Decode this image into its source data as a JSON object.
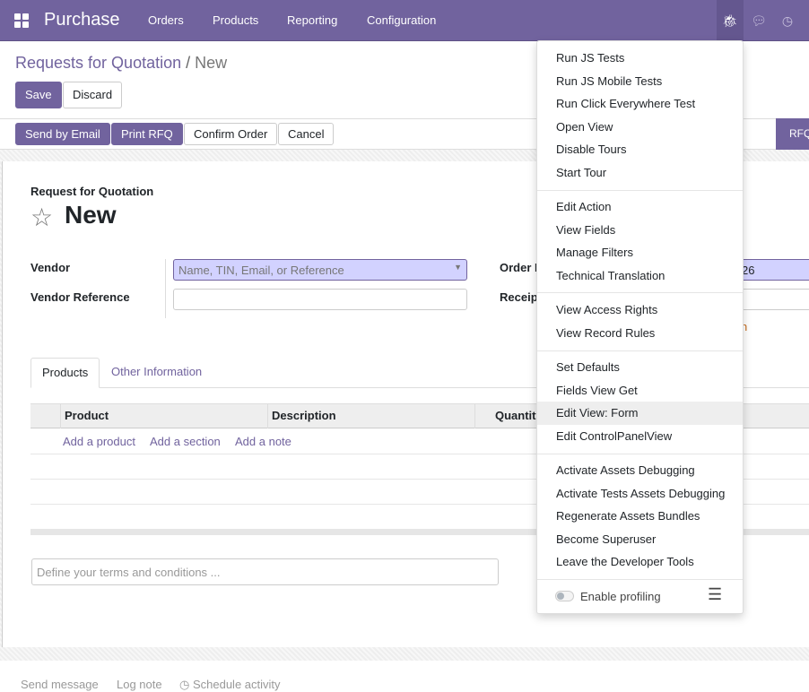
{
  "navbar": {
    "app_name": "Purchase",
    "menus": [
      "Orders",
      "Products",
      "Reporting",
      "Configuration"
    ],
    "icons": [
      "bug-icon",
      "chat-icon",
      "clock-icon"
    ]
  },
  "breadcrumb": {
    "parent": "Requests for Quotation",
    "separator": "/",
    "current": "New"
  },
  "buttons": {
    "save": "Save",
    "discard": "Discard"
  },
  "statusbar": {
    "send_email": "Send by Email",
    "print_rfq": "Print RFQ",
    "confirm": "Confirm Order",
    "cancel": "Cancel",
    "state": "RFQ"
  },
  "form": {
    "subtitle": "Request for Quotation",
    "title": "New",
    "vendor_label": "Vendor",
    "vendor_placeholder": "Name, TIN, Email, or Reference",
    "vendor_ref_label": "Vendor Reference",
    "order_label": "Order D",
    "receipt_label": "Receip",
    "order_value": "26",
    "link_partial": "n"
  },
  "tabs": [
    "Products",
    "Other Information"
  ],
  "table": {
    "headers": [
      "Product",
      "Description",
      "Quantity"
    ],
    "add_links": [
      "Add a product",
      "Add a section",
      "Add a note"
    ]
  },
  "terms_placeholder": "Define your terms and conditions ...",
  "chatter": {
    "send_message": "Send message",
    "log_note": "Log note",
    "schedule": "Schedule activity"
  },
  "debug_menu": {
    "groups": [
      [
        "Run JS Tests",
        "Run JS Mobile Tests",
        "Run Click Everywhere Test",
        "Open View",
        "Disable Tours",
        "Start Tour"
      ],
      [
        "Edit Action",
        "View Fields",
        "Manage Filters",
        "Technical Translation"
      ],
      [
        "View Access Rights",
        "View Record Rules"
      ],
      [
        "Set Defaults",
        "Fields View Get",
        "Edit View: Form",
        "Edit ControlPanelView"
      ],
      [
        "Activate Assets Debugging",
        "Activate Tests Assets Debugging",
        "Regenerate Assets Bundles",
        "Become Superuser",
        "Leave the Developer Tools"
      ]
    ],
    "highlighted": "Edit View: Form",
    "profiling_label": "Enable profiling",
    "profiling_enabled": false
  },
  "colors": {
    "brand": "#71639e",
    "required_field": "#d2d2ff"
  }
}
